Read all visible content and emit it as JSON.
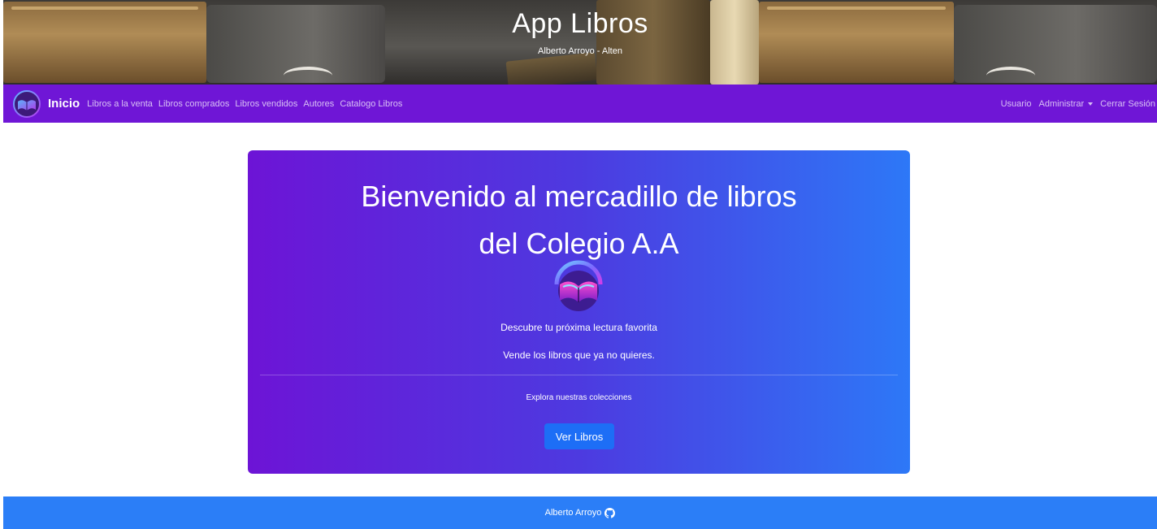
{
  "header": {
    "title": "App Libros",
    "subtitle": "Alberto Arroyo - Alten"
  },
  "navbar": {
    "brand_icon": "book-logo-icon",
    "brand": "Inicio",
    "left_links": [
      "Libros a la venta",
      "Libros comprados",
      "Libros vendidos",
      "Autores",
      "Catalogo Libros"
    ],
    "right_links": {
      "user": "Usuario",
      "admin": "Administrar",
      "logout": "Cerrar Sesión"
    },
    "dropdown_icon": "caret-down-icon"
  },
  "hero": {
    "title_line1": "Bienvenido al mercadillo de libros",
    "title_line2": "del Colegio A.A",
    "logo_icon": "book-logo-icon",
    "text1": "Descubre tu próxima lectura favorita",
    "text2": "Vende los libros que ya no quieres.",
    "explore": "Explora nuestras colecciones",
    "button": "Ver Libros"
  },
  "footer": {
    "author": "Alberto Arroyo",
    "icon": "github-icon"
  },
  "colors": {
    "navbar": "#6f16d6",
    "hero_start": "#6d14d6",
    "hero_end": "#2d78f7",
    "button": "#1d6ef6",
    "footer": "#2b7ef7"
  }
}
